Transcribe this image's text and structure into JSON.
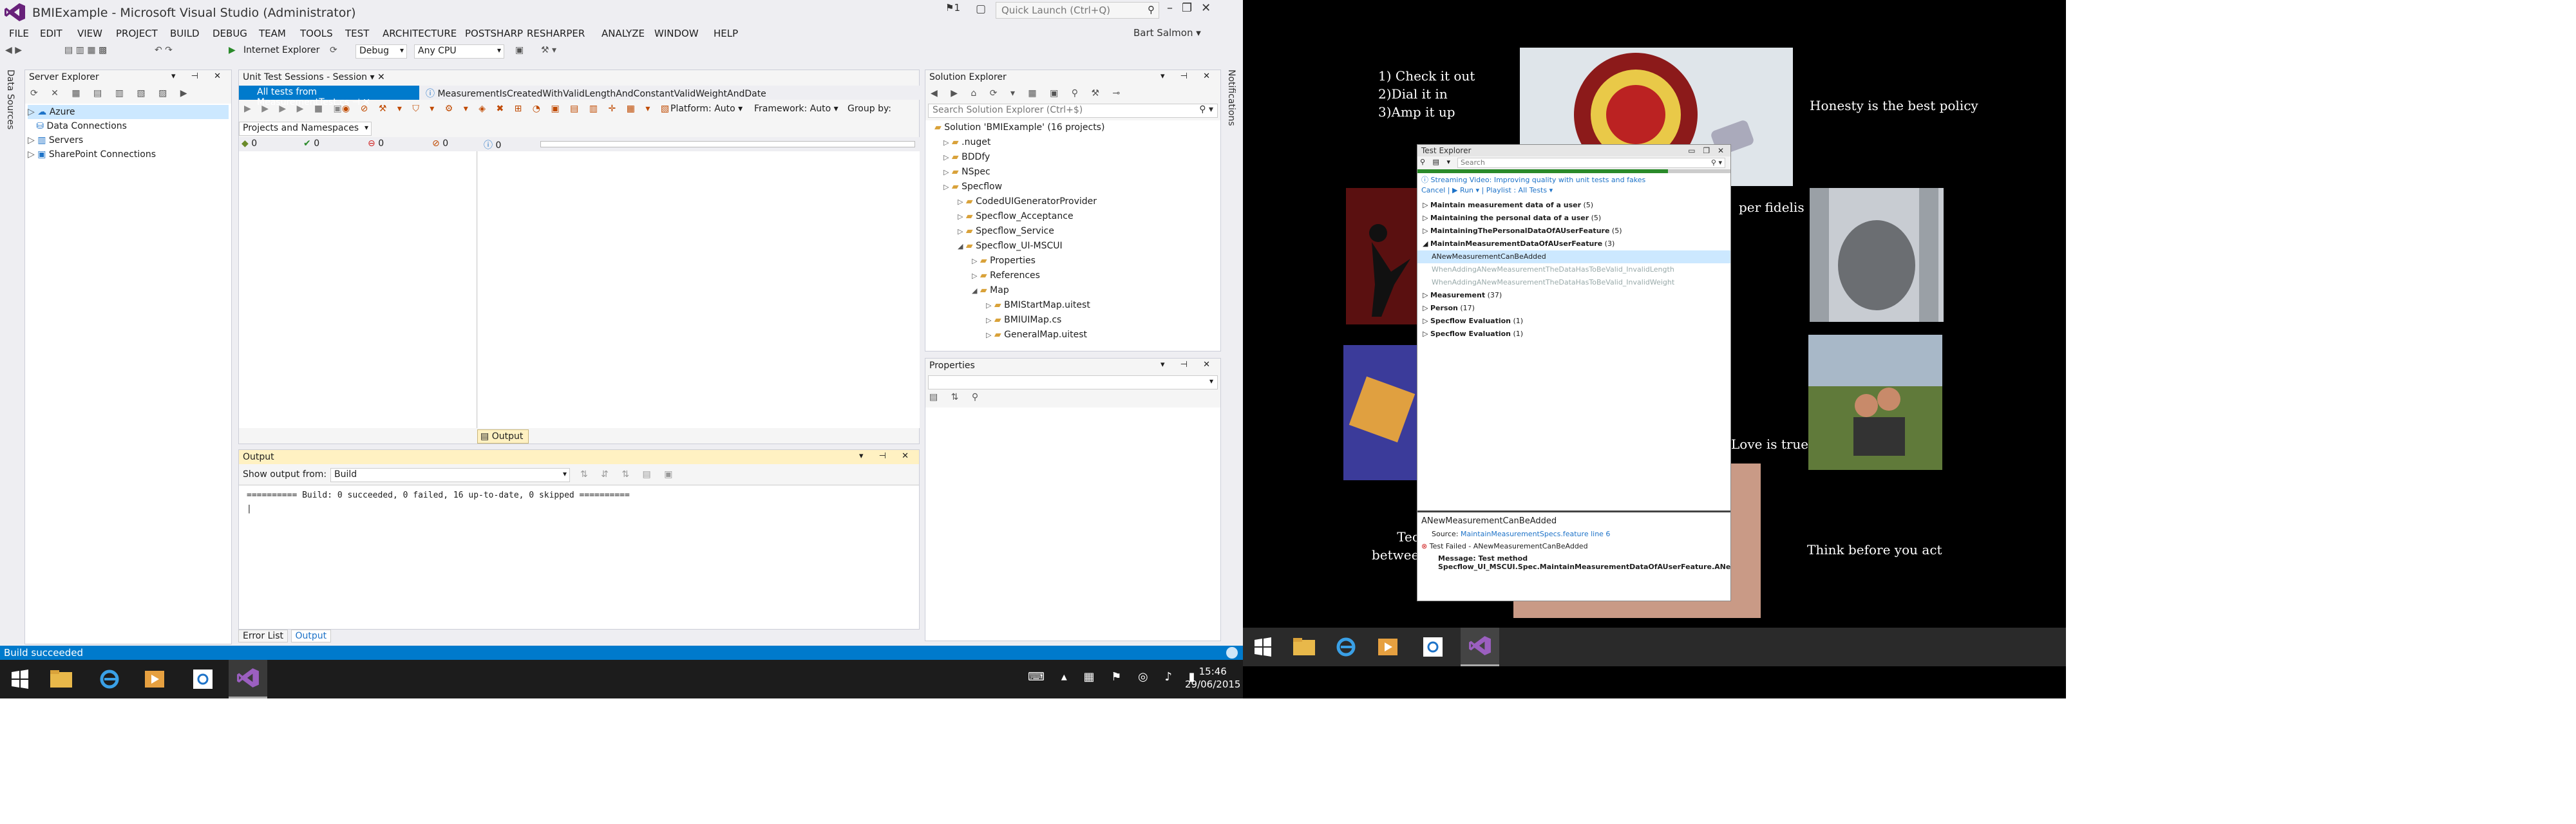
{
  "window": {
    "title": "BMIExample - Microsoft Visual Studio (Administrator)",
    "notify_count": "1",
    "quick_launch_placeholder": "Quick Launch (Ctrl+Q)",
    "user": "Bart Salmon"
  },
  "menu": [
    "FILE",
    "EDIT",
    "VIEW",
    "PROJECT",
    "BUILD",
    "DEBUG",
    "TEAM",
    "TOOLS",
    "TEST",
    "ARCHITECTURE",
    "POSTSHARP",
    "RESHARPER",
    "ANALYZE",
    "WINDOW",
    "HELP"
  ],
  "toolbar": {
    "browser": "Internet Explorer",
    "config": "Debug",
    "platform": "Any CPU"
  },
  "server_explorer": {
    "title": "Server Explorer",
    "items": [
      "Azure",
      "Data Connections",
      "Servers",
      "SharePoint Connections"
    ],
    "side_tab": "Data Sources"
  },
  "unit_test": {
    "title": "Unit Test Sessions - Session",
    "tab1": "All tests from MeasurementTest.cs",
    "tab2": "MeasurementIsCreatedWithValidLengthAndConstantValidWeightAndDate",
    "platform": "Platform: Auto",
    "framework": "Framework: Auto",
    "groupby": "Group by:",
    "group_combo": "Projects and Namespaces",
    "counts": [
      "0",
      "0",
      "0",
      "0",
      "0"
    ],
    "output_tab": "Output"
  },
  "solution_explorer": {
    "title": "Solution Explorer",
    "search_placeholder": "Search Solution Explorer (Ctrl+$)",
    "items": [
      {
        "label": "Solution 'BMIExample' (16 projects)",
        "indent": 0
      },
      {
        "label": ".nuget",
        "indent": 1
      },
      {
        "label": "BDDfy",
        "indent": 1
      },
      {
        "label": "NSpec",
        "indent": 1
      },
      {
        "label": "Specflow",
        "indent": 1
      },
      {
        "label": "CodedUIGeneratorProvider",
        "indent": 2
      },
      {
        "label": "Specflow_Acceptance",
        "indent": 2
      },
      {
        "label": "Specflow_Service",
        "indent": 2
      },
      {
        "label": "Specflow_UI-MSCUI",
        "indent": 2
      },
      {
        "label": "Properties",
        "indent": 3
      },
      {
        "label": "References",
        "indent": 3
      },
      {
        "label": "Map",
        "indent": 3
      },
      {
        "label": "BMIStartMap.uitest",
        "indent": 4
      },
      {
        "label": "BMIUIMap.cs",
        "indent": 4
      },
      {
        "label": "GeneralMap.uitest",
        "indent": 4
      }
    ],
    "side_tab": "Notifications"
  },
  "properties": {
    "title": "Properties"
  },
  "output": {
    "title": "Output",
    "show_from_label": "Show output from:",
    "source": "Build",
    "text": "========== Build: 0 succeeded, 0 failed, 16 up-to-date, 0 skipped ==========",
    "tabs": [
      "Error List",
      "Output"
    ]
  },
  "status": "Build succeeded",
  "taskbar": {
    "time": "15:46",
    "date": "29/06/2015"
  },
  "desktop2": {
    "quotes": [
      "1) Check it out\n2)Dial it in\n3)Amp it up",
      "Honesty is the best policy",
      "per fidelis",
      "Love is true",
      "Think before you act",
      "Techno\nbetween id"
    ]
  },
  "test_explorer": {
    "title": "Test Explorer",
    "search_placeholder": "Search",
    "banner": "Streaming Video: Improving quality with unit tests and fakes",
    "cancel": "Cancel",
    "run": "Run",
    "playlist": "Playlist : All Tests",
    "rows": [
      {
        "label": "Maintain measurement data of a user",
        "count": "(5)",
        "bold": true,
        "indent": 0
      },
      {
        "label": "Maintaining the personal data of a user",
        "count": "(5)",
        "bold": true,
        "indent": 0
      },
      {
        "label": "MaintainingThePersonalDataOfAUserFeature",
        "count": "(5)",
        "bold": true,
        "indent": 0
      },
      {
        "label": "MaintainMeasurementDataOfAUserFeature",
        "count": "(3)",
        "bold": true,
        "indent": 0
      },
      {
        "label": "ANewMeasurementCanBeAdded",
        "count": "",
        "bold": false,
        "indent": 1,
        "sel": true
      },
      {
        "label": "WhenAddingANewMeasurementTheDataHasToBeValid_InvalidLength",
        "count": "",
        "bold": false,
        "indent": 1,
        "dim": true
      },
      {
        "label": "WhenAddingANewMeasurementTheDataHasToBeValid_InvalidWeight",
        "count": "",
        "bold": false,
        "indent": 1,
        "dim": true
      },
      {
        "label": "Measurement",
        "count": "(37)",
        "bold": true,
        "indent": 0
      },
      {
        "label": "Person",
        "count": "(17)",
        "bold": true,
        "indent": 0
      },
      {
        "label": "Specflow Evaluation",
        "count": "(1)",
        "bold": true,
        "indent": 0
      },
      {
        "label": "Specflow Evaluation",
        "count": "(1)",
        "bold": true,
        "indent": 0
      }
    ],
    "detail_title": "ANewMeasurementCanBeAdded",
    "source_label": "Source:",
    "source_link": "MaintainMeasurementSpecs.feature line 6",
    "failed": "Test Failed - ANewMeasurementCanBeAdded",
    "message": "Message: Test method Specflow_UI_MSCUI.Spec.MaintainMeasurementDataOfAUserFeature.ANe"
  }
}
